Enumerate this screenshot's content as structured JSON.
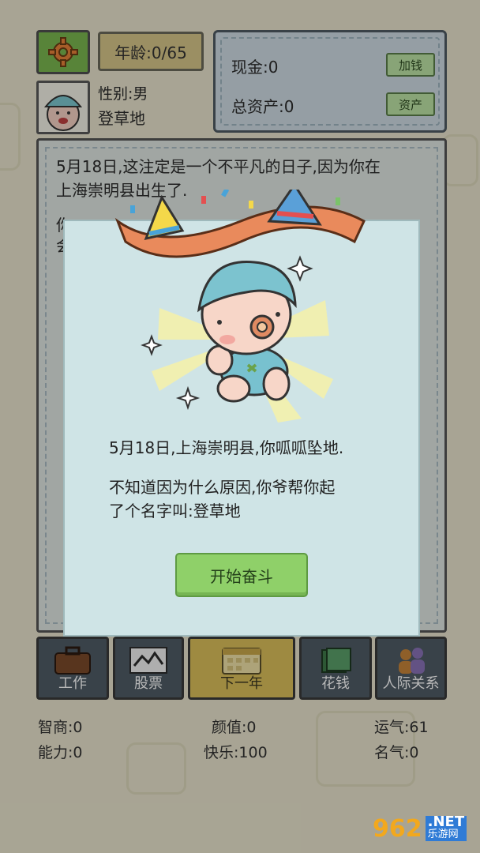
{
  "header": {
    "age": "年龄:0/65",
    "gender": "性别:男",
    "name": "登草地",
    "cash": "现金:0",
    "add_money_label": "加钱",
    "total_assets": "总资产:0",
    "assets_label": "资产"
  },
  "story": {
    "line1": "5月18日,这注定是一个不平凡的日子,因为你在",
    "line2": "上海崇明县出生了.",
    "line3_partial": "你",
    "line4_partial": "会"
  },
  "modal": {
    "text1": "5月18日,上海崇明县,你呱呱坠地.",
    "text2": "不知道因为什么原因,你爷帮你起",
    "text3": "了个名字叫:登草地",
    "start_button": "开始奋斗"
  },
  "actions": [
    {
      "label": "工作",
      "icon": "briefcase-icon"
    },
    {
      "label": "股票",
      "icon": "stock-chart-icon"
    },
    {
      "label": "下一年",
      "icon": "calendar-icon"
    },
    {
      "label": "花钱",
      "icon": "cash-icon"
    },
    {
      "label": "人际关系",
      "icon": "people-icon"
    }
  ],
  "stats": {
    "iq": "智商:0",
    "looks": "颜值:0",
    "luck": "运气:61",
    "ability": "能力:0",
    "happiness": "快乐:100",
    "fame": "名气:0"
  },
  "watermark": {
    "num": "962",
    "net": ".NET",
    "cn": "乐游网"
  },
  "colors": {
    "background": "#e9e4cd",
    "modal": "#cfe4e6",
    "button_green": "#8fd069",
    "panel_dark": "#4f5c66",
    "next_year": "#dcc05a"
  }
}
